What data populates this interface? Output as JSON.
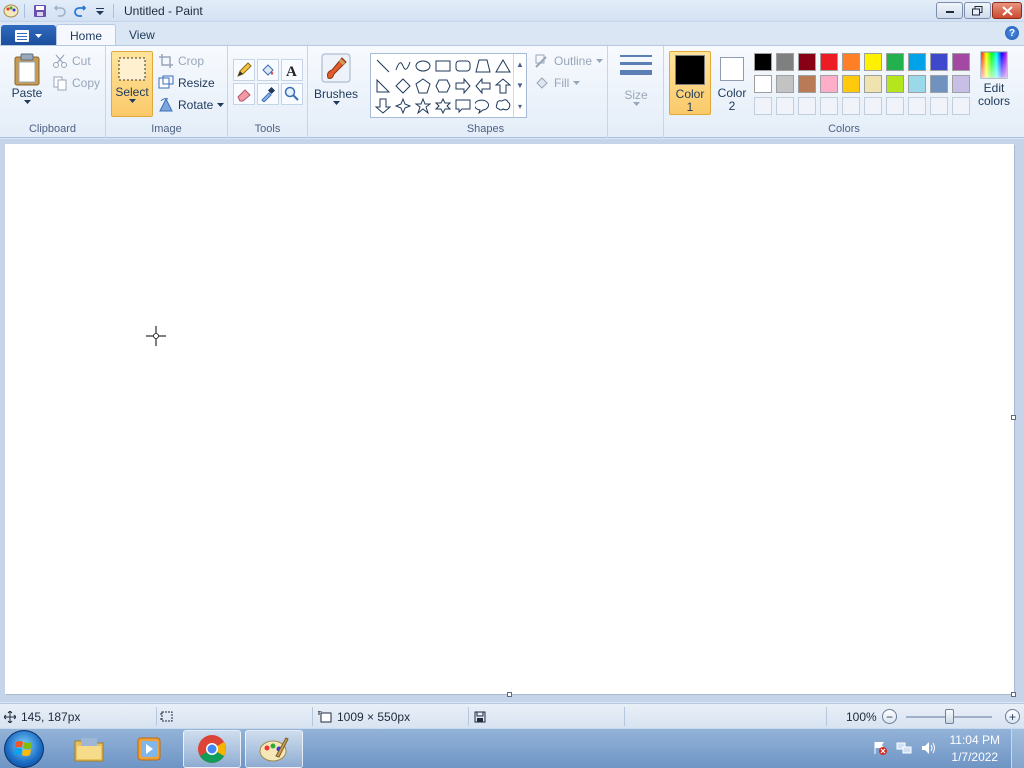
{
  "window": {
    "title": "Untitled - Paint"
  },
  "tabs": [
    {
      "label": "Home",
      "active": true
    },
    {
      "label": "View",
      "active": false
    }
  ],
  "clipboard": {
    "paste": "Paste",
    "cut": "Cut",
    "copy": "Copy",
    "label": "Clipboard"
  },
  "image": {
    "select": "Select",
    "crop": "Crop",
    "resize": "Resize",
    "rotate": "Rotate",
    "label": "Image"
  },
  "tools": {
    "label": "Tools",
    "items": [
      "pencil-icon",
      "fill-bucket-icon",
      "text-icon",
      "eraser-icon",
      "color-picker-icon",
      "magnifier-icon"
    ]
  },
  "brushes": {
    "label": "Brushes"
  },
  "shapes": {
    "label": "Shapes",
    "outline": "Outline",
    "fill": "Fill"
  },
  "size": {
    "label": "Size"
  },
  "colors": {
    "label": "Colors",
    "color1": "Color",
    "color1_num": "1",
    "color2": "Color",
    "color2_num": "2",
    "edit": "Edit",
    "edit2": "colors",
    "color1_value": "#000000",
    "color2_value": "#ffffff",
    "palette_row1": [
      "#000000",
      "#7f7f7f",
      "#880015",
      "#ed1c24",
      "#ff7f27",
      "#fff200",
      "#22b14c",
      "#00a2e8",
      "#3f48cc",
      "#a349a4"
    ],
    "palette_row2": [
      "#ffffff",
      "#c3c3c3",
      "#b97a57",
      "#ffaec9",
      "#ffc90e",
      "#efe4b0",
      "#b5e61d",
      "#99d9ea",
      "#7092be",
      "#c8bfe7"
    ]
  },
  "status": {
    "cursor_pos": "145, 187px",
    "canvas_size": "1009 × 550px",
    "zoom": "100%",
    "zoom_minus": "−",
    "zoom_plus": "+"
  },
  "taskbar": {
    "time": "11:04 PM",
    "date": "1/7/2022"
  }
}
